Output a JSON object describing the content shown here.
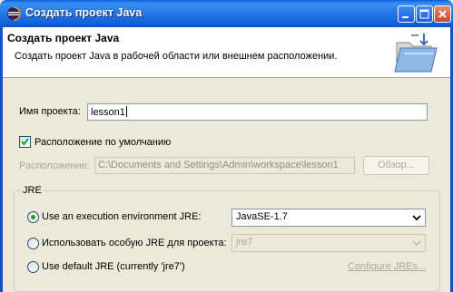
{
  "window": {
    "title": "Создать проект Java",
    "app_icon": "eclipse-icon"
  },
  "header": {
    "heading": "Создать проект Java",
    "description": "Создать проект Java в рабочей области или внешнем расположении.",
    "banner_icon": "java-project-folder-icon"
  },
  "form": {
    "project_name_label": "Имя проекта:",
    "project_name_value": "lesson1",
    "default_location_label": "Расположение по умолчанию",
    "default_location_checked": true,
    "location_label": "Расположение:",
    "location_value": "C:\\Documents and Settings\\Admin\\workspace\\lesson1",
    "browse_label": "Обзор..."
  },
  "jre": {
    "group_label": "JRE",
    "option_env_label": "Use an execution environment JRE:",
    "option_env_value": "JavaSE-1.7",
    "option_env_selected": true,
    "option_specific_label": "Использовать особую JRE для проекта:",
    "option_specific_value": "jre7",
    "option_default_label": "Use default JRE (currently 'jre7')",
    "configure_link": "Configure JREs..."
  },
  "colors": {
    "titlebar": "#1162d9",
    "dialog_bg": "#ece9d8",
    "disabled_text": "#aca899",
    "radio_selected": "#21a121"
  }
}
